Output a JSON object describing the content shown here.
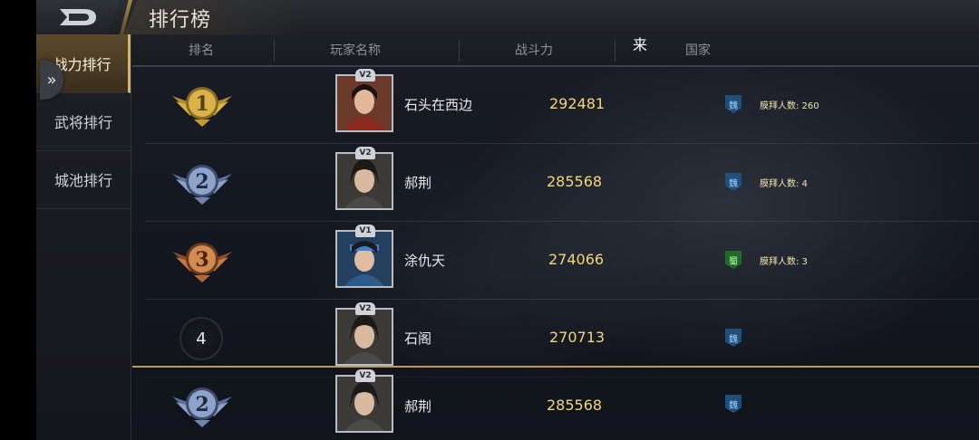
{
  "header": {
    "title": "排行榜"
  },
  "sidebar": {
    "items": [
      {
        "label": "战力排行",
        "active": true
      },
      {
        "label": "武将排行",
        "active": false
      },
      {
        "label": "城池排行",
        "active": false
      }
    ]
  },
  "table": {
    "columns": [
      "排名",
      "玩家名称",
      "战斗力",
      "国家"
    ],
    "floating_text": "来",
    "rows": [
      {
        "rank": 1,
        "rank_display": "medal-gold",
        "vip": "V2",
        "name": "石头在西边",
        "power": "292481",
        "nation": "魏",
        "worship": "膜拜人数: 260"
      },
      {
        "rank": 2,
        "rank_display": "medal-silver",
        "vip": "V2",
        "name": "郝荆",
        "power": "285568",
        "nation": "魏",
        "worship": "膜拜人数: 4"
      },
      {
        "rank": 3,
        "rank_display": "medal-bronze",
        "vip": "V1",
        "name": "涂仇天",
        "power": "274066",
        "nation": "蜀",
        "worship": "膜拜人数: 3"
      },
      {
        "rank": 4,
        "rank_display": "4",
        "vip": "V2",
        "name": "石阁",
        "power": "270713",
        "nation": "魏",
        "worship": ""
      }
    ],
    "my_row": {
      "rank": 2,
      "rank_display": "medal-silver",
      "vip": "V2",
      "name": "郝荆",
      "power": "285568",
      "nation": "魏"
    }
  },
  "colors": {
    "gold": "#d9b24a",
    "silver": "#8fa3c9",
    "bronze": "#c97a4a",
    "power": "#f1d77a",
    "wei": "#1f4f7a",
    "shu": "#1e6a2a"
  }
}
